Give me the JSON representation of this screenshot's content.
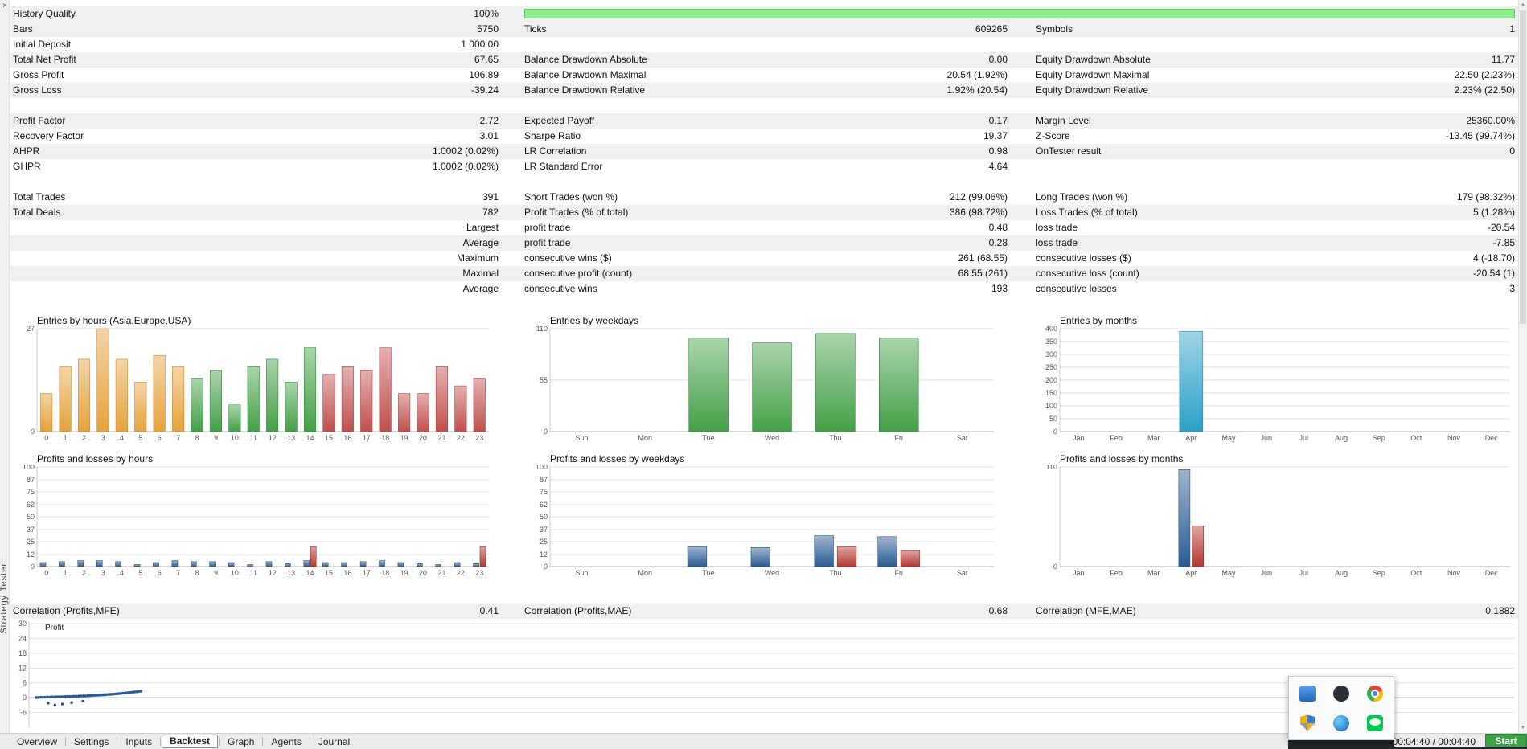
{
  "window": {
    "close": "×",
    "vertical_title": "Strategy Tester",
    "scroll_up": "▲",
    "scroll_down": "▼"
  },
  "stats": {
    "history_quality": {
      "label": "History Quality",
      "value": "100%",
      "percent": 100,
      "bar_color": "#8FEF8F"
    },
    "rows": [
      {
        "l1": "Bars",
        "v1": "5750",
        "l2": "Ticks",
        "v2": "609265",
        "l3": "Symbols",
        "v3": "1"
      },
      {
        "l1": "Initial Deposit",
        "v1": "1 000.00",
        "l2": "",
        "v2": "",
        "l3": "",
        "v3": ""
      },
      {
        "l1": "Total Net Profit",
        "v1": "67.65",
        "l2": "Balance Drawdown Absolute",
        "v2": "0.00",
        "l3": "Equity Drawdown Absolute",
        "v3": "11.77"
      },
      {
        "l1": "Gross Profit",
        "v1": "106.89",
        "l2": "Balance Drawdown Maximal",
        "v2": "20.54 (1.92%)",
        "l3": "Equity Drawdown Maximal",
        "v3": "22.50 (2.23%)"
      },
      {
        "l1": "Gross Loss",
        "v1": "-39.24",
        "l2": "Balance Drawdown Relative",
        "v2": "1.92% (20.54)",
        "l3": "Equity Drawdown Relative",
        "v3": "2.23% (22.50)"
      },
      {
        "l1": "",
        "v1": "",
        "l2": "",
        "v2": "",
        "l3": "",
        "v3": ""
      },
      {
        "l1": "Profit Factor",
        "v1": "2.72",
        "l2": "Expected Payoff",
        "v2": "0.17",
        "l3": "Margin Level",
        "v3": "25360.00%"
      },
      {
        "l1": "Recovery Factor",
        "v1": "3.01",
        "l2": "Sharpe Ratio",
        "v2": "19.37",
        "l3": "Z-Score",
        "v3": "-13.45 (99.74%)"
      },
      {
        "l1": "AHPR",
        "v1": "1.0002 (0.02%)",
        "l2": "LR Correlation",
        "v2": "0.98",
        "l3": "OnTester result",
        "v3": "0"
      },
      {
        "l1": "GHPR",
        "v1": "1.0002 (0.02%)",
        "l2": "LR Standard Error",
        "v2": "4.64",
        "l3": "",
        "v3": ""
      },
      {
        "l1": "",
        "v1": "",
        "l2": "",
        "v2": "",
        "l3": "",
        "v3": ""
      },
      {
        "l1": "Total Trades",
        "v1": "391",
        "l2": "Short Trades (won %)",
        "v2": "212 (99.06%)",
        "l3": "Long Trades (won %)",
        "v3": "179 (98.32%)"
      },
      {
        "l1": "Total Deals",
        "v1": "782",
        "l2": "Profit Trades (% of total)",
        "v2": "386 (98.72%)",
        "l3": "Loss Trades (% of total)",
        "v3": "5 (1.28%)"
      },
      {
        "l1": "",
        "v1": "Largest",
        "l2": "profit trade",
        "v2": "0.48",
        "l3": "loss trade",
        "v3": "-20.54"
      },
      {
        "l1": "",
        "v1": "Average",
        "l2": "profit trade",
        "v2": "0.28",
        "l3": "loss trade",
        "v3": "-7.85"
      },
      {
        "l1": "",
        "v1": "Maximum",
        "l2": "consecutive wins ($)",
        "v2": "261 (68.55)",
        "l3": "consecutive losses ($)",
        "v3": "4 (-18.70)"
      },
      {
        "l1": "",
        "v1": "Maximal",
        "l2": "consecutive profit (count)",
        "v2": "68.55 (261)",
        "l3": "consecutive loss (count)",
        "v3": "-20.54 (1)"
      },
      {
        "l1": "",
        "v1": "Average",
        "l2": "consecutive wins",
        "v2": "193",
        "l3": "consecutive losses",
        "v3": "3"
      }
    ]
  },
  "correlation": {
    "l1": "Correlation (Profits,MFE)",
    "v1": "0.41",
    "l2": "Correlation (Profits,MAE)",
    "v2": "0.68",
    "l3": "Correlation (MFE,MAE)",
    "v3": "0.1882"
  },
  "chart_data": [
    {
      "type": "bar",
      "title": "Entries by hours (Asia,Europe,USA)",
      "categories": [
        "0",
        "1",
        "2",
        "3",
        "4",
        "5",
        "6",
        "7",
        "8",
        "9",
        "10",
        "11",
        "12",
        "13",
        "14",
        "15",
        "16",
        "17",
        "18",
        "19",
        "20",
        "21",
        "22",
        "23"
      ],
      "values": [
        10,
        17,
        19,
        27,
        19,
        13,
        20,
        17,
        14,
        16,
        7,
        17,
        19,
        13,
        22,
        15,
        17,
        16,
        22,
        10,
        10,
        17,
        12,
        14
      ],
      "bar_colors": [
        "#E5A23C",
        "#E5A23C",
        "#E5A23C",
        "#E5A23C",
        "#E5A23C",
        "#E5A23C",
        "#E5A23C",
        "#E5A23C",
        "#43A047",
        "#43A047",
        "#43A047",
        "#43A047",
        "#43A047",
        "#43A047",
        "#43A047",
        "#C0504D",
        "#C0504D",
        "#C0504D",
        "#C0504D",
        "#C0504D",
        "#C0504D",
        "#C0504D",
        "#C0504D",
        "#C0504D"
      ],
      "ylim": [
        0,
        27
      ],
      "ticks": [
        0,
        27
      ]
    },
    {
      "type": "bar",
      "title": "Entries by weekdays",
      "categories": [
        "Sun",
        "Mon",
        "Tue",
        "Wed",
        "Thu",
        "Fri",
        "Sat"
      ],
      "values": [
        0,
        0,
        100,
        95,
        105,
        100,
        0
      ],
      "color": "#43A047",
      "ylim": [
        0,
        110
      ],
      "ticks": [
        0,
        55,
        110
      ]
    },
    {
      "type": "bar",
      "title": "Entries by months",
      "categories": [
        "Jan",
        "Feb",
        "Mar",
        "Apr",
        "May",
        "Jun",
        "Jul",
        "Aug",
        "Sep",
        "Oct",
        "Nov",
        "Dec"
      ],
      "values": [
        0,
        0,
        0,
        390,
        0,
        0,
        0,
        0,
        0,
        0,
        0,
        0
      ],
      "color": "#2AA0C8",
      "ylim": [
        0,
        400
      ],
      "ticks": [
        0,
        50,
        100,
        150,
        200,
        250,
        300,
        350,
        400
      ]
    },
    {
      "type": "grouped",
      "title": "Profits and losses by hours",
      "categories": [
        "0",
        "1",
        "2",
        "3",
        "4",
        "5",
        "6",
        "7",
        "8",
        "9",
        "10",
        "11",
        "12",
        "13",
        "14",
        "15",
        "16",
        "17",
        "18",
        "19",
        "20",
        "21",
        "22",
        "23"
      ],
      "series": [
        {
          "name": "profit",
          "color": "#2B5B93",
          "values": [
            4,
            5,
            6,
            6,
            5,
            2,
            4,
            6,
            5,
            5,
            4,
            2,
            5,
            3,
            6,
            4,
            4,
            5,
            6,
            4,
            3,
            2,
            4,
            3
          ]
        },
        {
          "name": "loss",
          "color": "#B23830",
          "values": [
            0,
            0,
            0,
            0,
            0,
            0,
            0,
            0,
            0,
            0,
            0,
            0,
            0,
            0,
            20,
            0,
            0,
            0,
            0,
            0,
            0,
            0,
            0,
            20
          ]
        }
      ],
      "ylim": [
        0,
        100
      ],
      "ticks": [
        0,
        12,
        25,
        37,
        50,
        62,
        75,
        87,
        100
      ]
    },
    {
      "type": "grouped",
      "title": "Profits and losses by weekdays",
      "categories": [
        "Sun",
        "Mon",
        "Tue",
        "Wed",
        "Thu",
        "Fri",
        "Sat"
      ],
      "series": [
        {
          "name": "profit",
          "color": "#2B5B93",
          "values": [
            0,
            0,
            20,
            19,
            31,
            30,
            0
          ]
        },
        {
          "name": "loss",
          "color": "#B23830",
          "values": [
            0,
            0,
            0,
            0,
            20,
            16,
            0
          ]
        }
      ],
      "ylim": [
        0,
        100
      ],
      "ticks": [
        0,
        12,
        25,
        37,
        50,
        62,
        75,
        87,
        100
      ]
    },
    {
      "type": "grouped",
      "title": "Profits and losses by months",
      "categories": [
        "Jan",
        "Feb",
        "Mar",
        "Apr",
        "May",
        "Jun",
        "Jul",
        "Aug",
        "Sep",
        "Oct",
        "Nov",
        "Dec"
      ],
      "series": [
        {
          "name": "profit",
          "color": "#2B5B93",
          "values": [
            0,
            0,
            0,
            107,
            0,
            0,
            0,
            0,
            0,
            0,
            0,
            0
          ]
        },
        {
          "name": "loss",
          "color": "#B23830",
          "values": [
            0,
            0,
            0,
            45,
            0,
            0,
            0,
            0,
            0,
            0,
            0,
            0
          ]
        }
      ],
      "ylim": [
        0,
        110
      ],
      "ticks": [
        0,
        110
      ]
    },
    {
      "type": "scatter",
      "title": "",
      "legend": "Profit",
      "color": "#2B5B93",
      "xlim": [
        0,
        400
      ],
      "ylim": [
        -12,
        31
      ],
      "ticks": [
        -6,
        0,
        6,
        12,
        18,
        24,
        30
      ],
      "points": [
        [
          2,
          0.1
        ],
        [
          2.6,
          0.12
        ],
        [
          3.2,
          0.18
        ],
        [
          3.8,
          0.15
        ],
        [
          4.4,
          0.22
        ],
        [
          5,
          0.25
        ],
        [
          5.6,
          0.22
        ],
        [
          6.2,
          0.3
        ],
        [
          6.8,
          0.28
        ],
        [
          7.4,
          0.35
        ],
        [
          8,
          0.38
        ],
        [
          8.6,
          0.35
        ],
        [
          9.2,
          0.42
        ],
        [
          9.8,
          0.45
        ],
        [
          10.4,
          0.5
        ],
        [
          11,
          0.48
        ],
        [
          11.6,
          0.55
        ],
        [
          12.2,
          0.6
        ],
        [
          12.8,
          0.58
        ],
        [
          13.4,
          0.65
        ],
        [
          14,
          0.7
        ],
        [
          14.6,
          0.75
        ],
        [
          15.2,
          0.72
        ],
        [
          15.8,
          0.8
        ],
        [
          16.4,
          0.85
        ],
        [
          17,
          0.9
        ],
        [
          17.6,
          0.95
        ],
        [
          18.2,
          1.0
        ],
        [
          18.8,
          1.05
        ],
        [
          19.4,
          1.1
        ],
        [
          20,
          1.15
        ],
        [
          20.6,
          1.22
        ],
        [
          21.2,
          1.28
        ],
        [
          21.8,
          1.35
        ],
        [
          22.4,
          1.42
        ],
        [
          23,
          1.5
        ],
        [
          23.6,
          1.58
        ],
        [
          24.2,
          1.66
        ],
        [
          24.8,
          1.74
        ],
        [
          25.4,
          1.83
        ],
        [
          26,
          1.92
        ],
        [
          26.6,
          2.02
        ],
        [
          27.2,
          2.12
        ],
        [
          27.8,
          2.22
        ],
        [
          28.4,
          2.33
        ],
        [
          29,
          2.44
        ],
        [
          29.6,
          2.55
        ],
        [
          30.2,
          2.66
        ],
        [
          5.2,
          -2.2
        ],
        [
          7,
          -3.0
        ],
        [
          9,
          -2.6
        ],
        [
          11.5,
          -2.0
        ],
        [
          14.5,
          -1.4
        ]
      ]
    }
  ],
  "tabs": {
    "items": [
      "Overview",
      "Settings",
      "Inputs",
      "Backtest",
      "Graph",
      "Agents",
      "Journal"
    ],
    "active": "Backtest",
    "time": "00:04:40 / 00:04:40",
    "start_label": "Start",
    "start_color": "#3BA245"
  },
  "tray": {
    "icons": [
      "app-window",
      "github",
      "chrome",
      "defender-shield",
      "edge-browser",
      "line-chat"
    ]
  }
}
